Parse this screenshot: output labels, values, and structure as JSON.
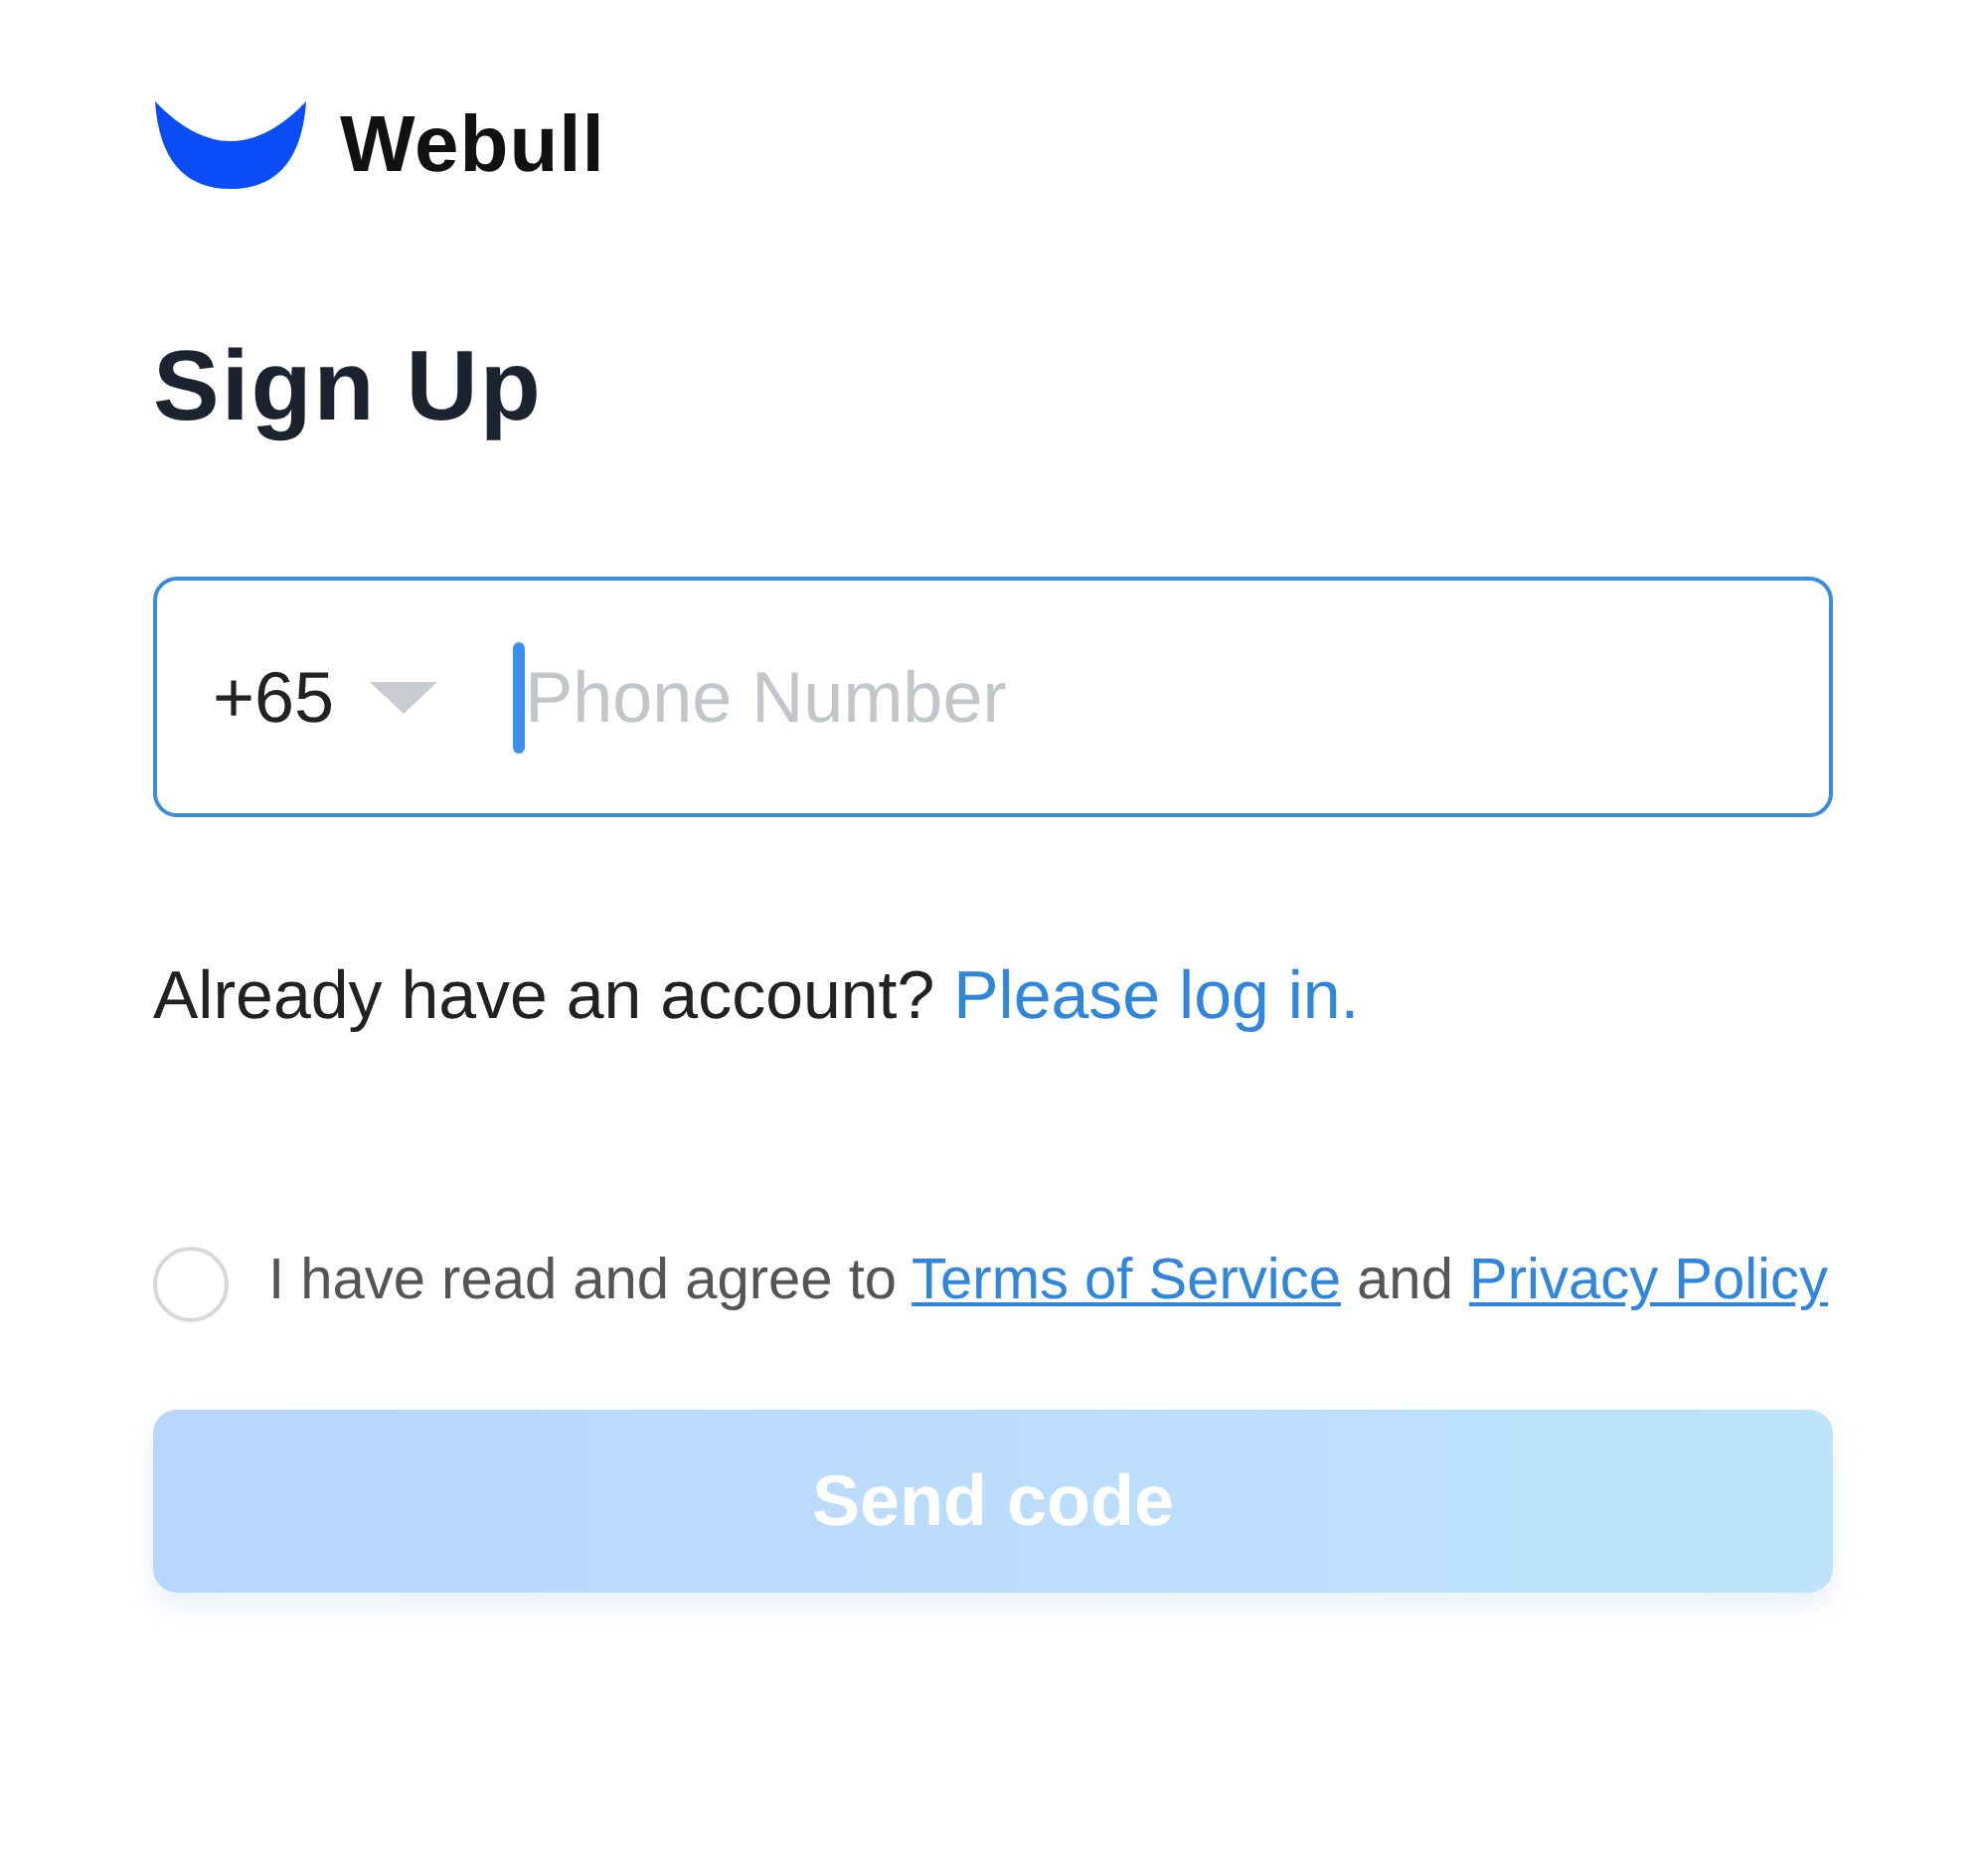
{
  "logo": {
    "text": "Webull"
  },
  "title": "Sign Up",
  "phone_field": {
    "country_code": "+65",
    "placeholder": "Phone Number",
    "focused": true
  },
  "login_prompt": {
    "text": "Already have an account?",
    "link": "Please log in."
  },
  "agreement": {
    "checked": false,
    "segments": [
      {
        "kind": "text",
        "text": "I have read and agree to "
      },
      {
        "kind": "link",
        "text": "Terms of Service"
      },
      {
        "kind": "text",
        "text": " and "
      },
      {
        "kind": "link",
        "text": "Privacy Policy"
      }
    ]
  },
  "send_button": {
    "label": "Send code",
    "disabled": true
  }
}
